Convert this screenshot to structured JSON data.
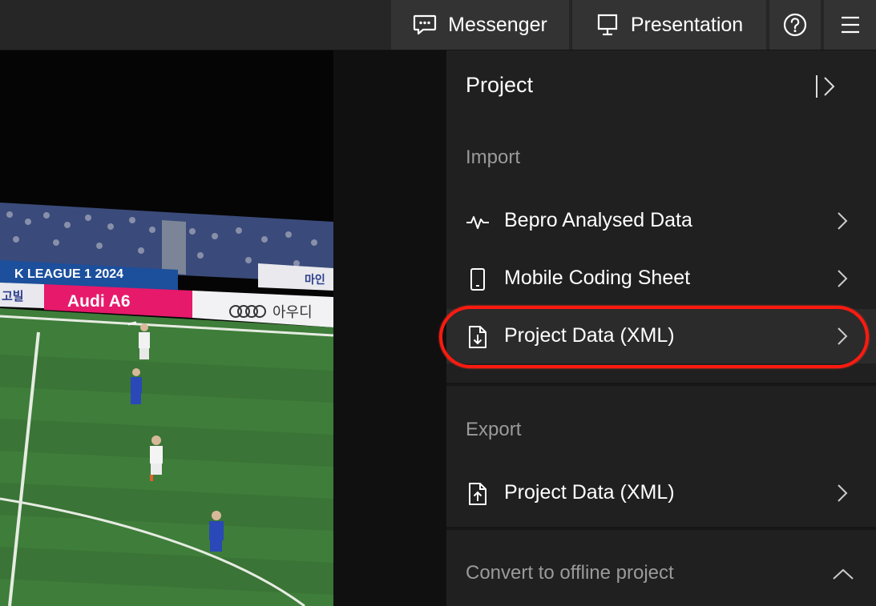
{
  "topbar": {
    "messenger_label": "Messenger",
    "presentation_label": "Presentation",
    "icons": [
      "chat-bubble-icon",
      "monitor-icon",
      "help-icon",
      "hamburger-menu-icon"
    ]
  },
  "video": {
    "board_league_text": "K LEAGUE 1 2024",
    "board_audi_text": "Audi A6",
    "board_audi_korean": "아우디",
    "board_side_text": "마인",
    "board_left_text": "고빌"
  },
  "panel": {
    "title": "Project",
    "import_heading": "Import",
    "import_items": [
      {
        "label": "Bepro Analysed Data",
        "icon": "pulse-icon"
      },
      {
        "label": "Mobile Coding Sheet",
        "icon": "mobile-phone-icon"
      },
      {
        "label": "Project Data (XML)",
        "icon": "file-download-icon"
      }
    ],
    "export_heading": "Export",
    "export_items": [
      {
        "label": "Project Data (XML)",
        "icon": "file-upload-icon"
      }
    ],
    "convert_label": "Convert to offline project"
  },
  "colors": {
    "topbar_bg": "#262626",
    "button_bg": "#333333",
    "panel_bg": "#202020",
    "highlight_ring": "#ff1a10",
    "pitch_green": "#3f7d3a"
  }
}
